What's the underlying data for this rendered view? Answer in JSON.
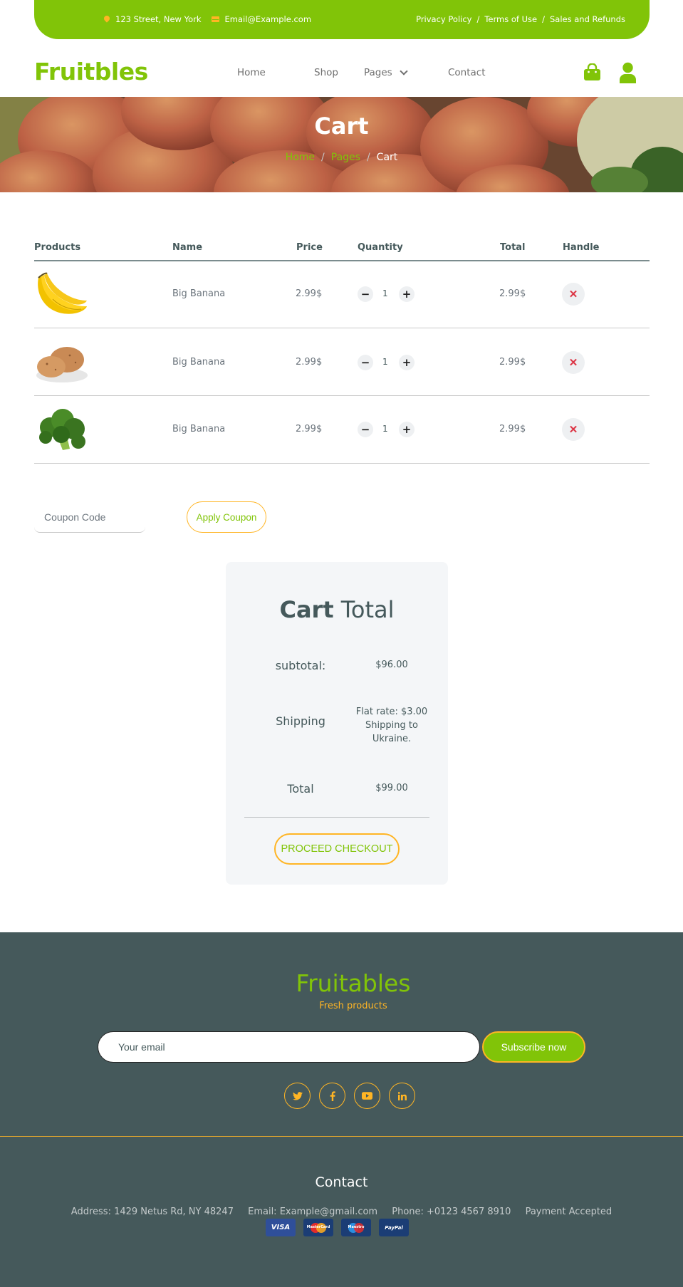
{
  "topbar": {
    "address": "123 Street, New York",
    "email": "Email@Example.com",
    "links": [
      {
        "label": "Privacy Policy"
      },
      {
        "label": "Terms of Use"
      },
      {
        "label": "Sales and Refunds"
      }
    ],
    "separator": "/"
  },
  "brand": {
    "logo": "Fruitbles"
  },
  "nav": {
    "home": "Home",
    "shop": "Shop",
    "pages": "Pages",
    "contact": "Contact"
  },
  "hero": {
    "title": "Cart",
    "breadcrumb": {
      "home": "Home",
      "pages": "Pages",
      "current": "Cart",
      "separator": "/"
    }
  },
  "cart": {
    "columns": {
      "products": "Products",
      "name": "Name",
      "price": "Price",
      "quantity": "Quantity",
      "total": "Total",
      "handle": "Handle"
    },
    "rows": [
      {
        "image": "banana",
        "name": "Big Banana",
        "price": "2.99$",
        "qty": "1",
        "total": "2.99$",
        "minus": "−",
        "plus": "+",
        "remove": "✕"
      },
      {
        "image": "potato",
        "name": "Big Banana",
        "price": "2.99$",
        "qty": "1",
        "total": "2.99$",
        "minus": "−",
        "plus": "+",
        "remove": "✕"
      },
      {
        "image": "broccoli",
        "name": "Big Banana",
        "price": "2.99$",
        "qty": "1",
        "total": "2.99$",
        "minus": "−",
        "plus": "+",
        "remove": "✕"
      }
    ]
  },
  "coupon": {
    "placeholder": "Coupon Code",
    "apply_label": "Apply Coupon"
  },
  "totals": {
    "title_bold": "Cart",
    "title_light": "Total",
    "subtotal_label": "subtotal:",
    "subtotal_value": "$96.00",
    "shipping_label": "Shipping",
    "shipping_line1": "Flat rate: $3.00",
    "shipping_line2": "Shipping to",
    "shipping_line3": "Ukraine.",
    "total_label": "Total",
    "total_value": "$99.00",
    "checkout_label": "PROCEED CHECKOUT"
  },
  "footer": {
    "brand": "Fruitables",
    "tagline": "Fresh products",
    "email_placeholder": "Your email",
    "subscribe_label": "Subscribe now",
    "socials": [
      "twitter-icon",
      "facebook-icon",
      "youtube-icon",
      "linkedin-icon"
    ],
    "contact_title": "Contact",
    "address": "Address: 1429 Netus Rd, NY 48247",
    "email": "Email: Example@gmail.com",
    "phone": "Phone: +0123 4567 8910",
    "payment": "Payment Accepted",
    "cards": {
      "visa": "VISA",
      "mastercard": "MasterCard",
      "maestro": "Maestro",
      "paypal": "PayPal"
    }
  },
  "colors": {
    "primary": "#81c408",
    "secondary": "#ffb524",
    "dark": "#45595b",
    "danger": "#dc3545"
  }
}
